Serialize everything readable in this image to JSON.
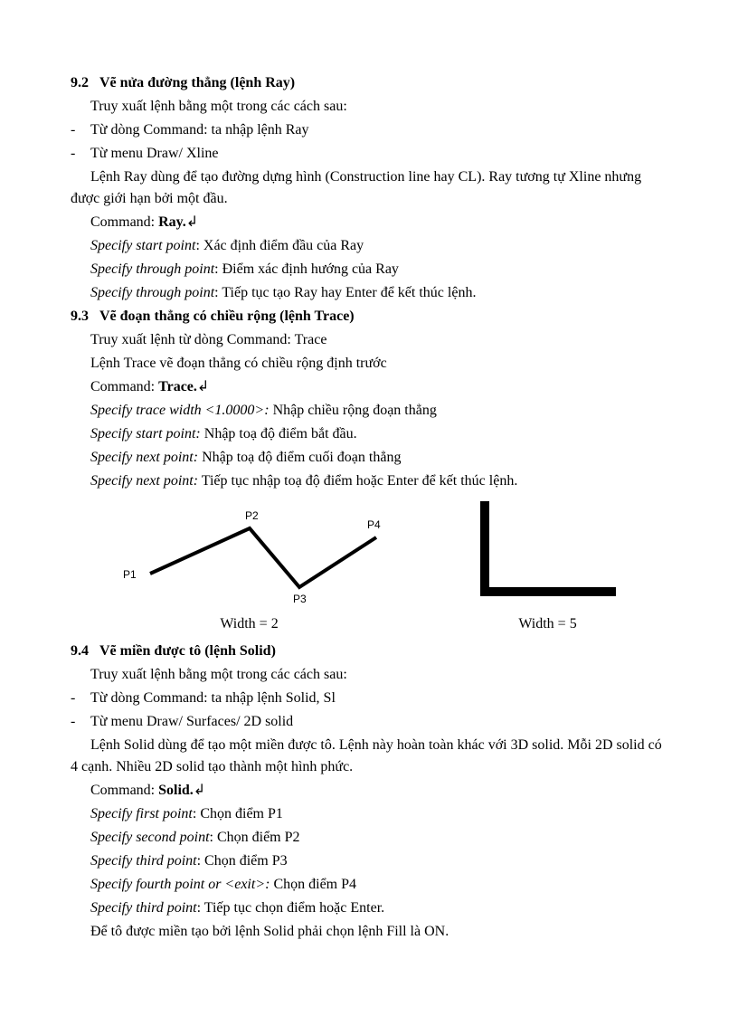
{
  "s92": {
    "heading_num": "9.2",
    "heading_text": "Vẽ nửa đường thẳng (lệnh Ray)",
    "intro": "Truy xuất lệnh bằng một trong các cách sau:",
    "b1": "Từ dòng Command: ta nhập lệnh Ray",
    "b2": "Từ menu Draw/ Xline",
    "desc": "Lệnh Ray dùng để tạo đường dựng hình (Construction line hay CL). Ray tương tự Xline nhưng được giới hạn bởi một đầu.",
    "cmd_label": "Command: ",
    "cmd_value": "Ray.",
    "l1_i": "Specify start point",
    "l1_r": ": Xác định điểm đầu của Ray",
    "l2_i": "Specify through point",
    "l2_r": ": Điểm xác định hướng của Ray",
    "l3_i": "Specify through point",
    "l3_r": ": Tiếp tục tạo Ray hay Enter để kết thúc lệnh."
  },
  "s93": {
    "heading_num": "9.3",
    "heading_text": "Vẽ đoạn thẳng có chiều rộng (lệnh Trace)",
    "intro": "Truy xuất lệnh từ dòng Command: Trace",
    "desc": "Lệnh Trace vẽ đoạn thẳng có chiều rộng định trước",
    "cmd_label": "Command: ",
    "cmd_value": "Trace.",
    "l1_i": "Specify trace width <1.0000>:",
    "l1_r": "  Nhập chiều rộng đoạn thẳng",
    "l2_i": "Specify start point:",
    "l2_r": " Nhập toạ độ điểm bắt đầu.",
    "l3_i": "Specify next point:",
    "l3_r": " Nhập toạ độ điểm cuối đoạn thẳng",
    "l4_i": "Specify next point:",
    "l4_r": " Tiếp tục nhập toạ độ điểm hoặc Enter để kết thúc lệnh.",
    "fig1_caption": "Width = 2",
    "fig2_caption": "Width = 5",
    "p1": "P1",
    "p2": "P2",
    "p3": "P3",
    "p4": "P4"
  },
  "s94": {
    "heading_num": "9.4",
    "heading_text": "Vẽ miền được tô (lệnh Solid)",
    "intro": "Truy xuất lệnh bằng một trong các cách sau:",
    "b1": "Từ dòng Command: ta nhập lệnh Solid, Sl",
    "b2": "Từ menu Draw/ Surfaces/ 2D solid",
    "desc": "Lệnh Solid dùng để tạo một miền được tô. Lệnh này hoàn toàn khác với 3D solid. Mỗi 2D solid có 4 cạnh. Nhiều 2D solid tạo thành một hình phức.",
    "cmd_label": "Command: ",
    "cmd_value": "Solid.",
    "l1_i": "Specify first point",
    "l1_r": ": Chọn điểm P1",
    "l2_i": "Specify second point",
    "l2_r": ": Chọn điểm P2",
    "l3_i": "Specify third point",
    "l3_r": ": Chọn điểm P3",
    "l4_i": "Specify fourth point or <exit>:",
    "l4_r": " Chọn điểm P4",
    "l5_i": "Specify third point",
    "l5_r": ": Tiếp tục chọn điểm hoặc Enter.",
    "note": "Để tô được miền tạo bởi lệnh Solid phải chọn lệnh Fill là ON."
  },
  "sym": {
    "bullet": "-",
    "enter": "↲"
  }
}
